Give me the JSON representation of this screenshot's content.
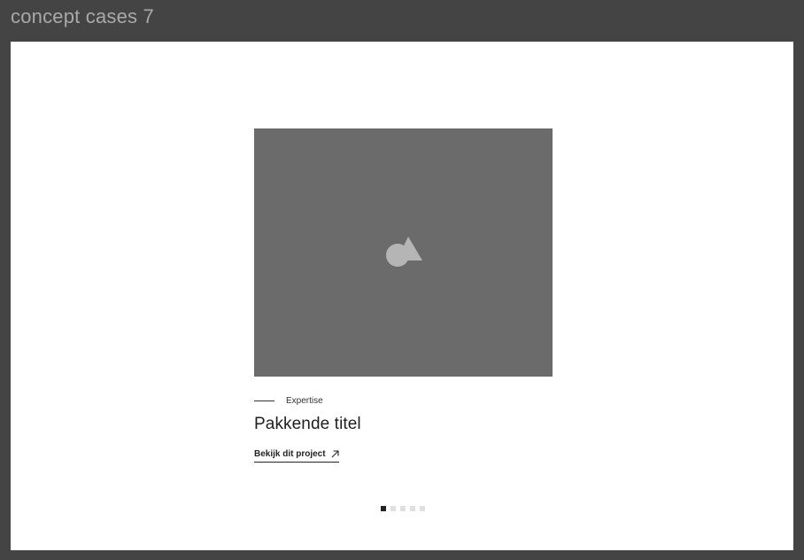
{
  "frame": {
    "title": "concept cases 7"
  },
  "card": {
    "image_icon": "image-placeholder-icon",
    "category": "Expertise",
    "title": "Pakkende titel",
    "link_label": "Bekijk dit project",
    "link_icon": "arrow-up-right-icon"
  },
  "pagination": {
    "total": 5,
    "active_index": 0
  },
  "colors": {
    "frame_background": "#444444",
    "canvas_background": "#ffffff",
    "image_background": "#6b6b6b",
    "text_primary": "#1f1f1f",
    "dot_active": "#222222",
    "dot_inactive": "#e0e0e0"
  }
}
